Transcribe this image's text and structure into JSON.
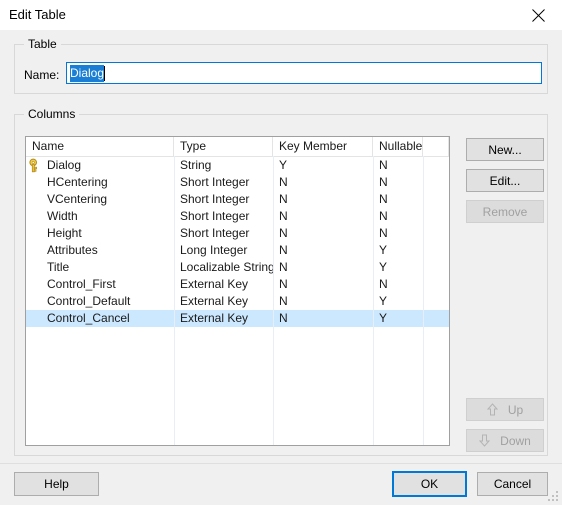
{
  "window": {
    "title": "Edit Table",
    "close_icon": "close-icon"
  },
  "table_group": {
    "legend": "Table",
    "name_label": "Name:",
    "name_value": "Dialog",
    "name_placeholder": ""
  },
  "columns_group": {
    "legend": "Columns",
    "headers": [
      "Name",
      "Type",
      "Key Member",
      "Nullable",
      ""
    ],
    "rows": [
      {
        "name": "Dialog",
        "type": "String",
        "key_member": "Y",
        "nullable": "N",
        "is_key": true,
        "selected": false
      },
      {
        "name": "HCentering",
        "type": "Short Integer",
        "key_member": "N",
        "nullable": "N",
        "is_key": false,
        "selected": false
      },
      {
        "name": "VCentering",
        "type": "Short Integer",
        "key_member": "N",
        "nullable": "N",
        "is_key": false,
        "selected": false
      },
      {
        "name": "Width",
        "type": "Short Integer",
        "key_member": "N",
        "nullable": "N",
        "is_key": false,
        "selected": false
      },
      {
        "name": "Height",
        "type": "Short Integer",
        "key_member": "N",
        "nullable": "N",
        "is_key": false,
        "selected": false
      },
      {
        "name": "Attributes",
        "type": "Long Integer",
        "key_member": "N",
        "nullable": "Y",
        "is_key": false,
        "selected": false
      },
      {
        "name": "Title",
        "type": "Localizable String",
        "key_member": "N",
        "nullable": "Y",
        "is_key": false,
        "selected": false
      },
      {
        "name": "Control_First",
        "type": "External Key",
        "key_member": "N",
        "nullable": "N",
        "is_key": false,
        "selected": false
      },
      {
        "name": "Control_Default",
        "type": "External Key",
        "key_member": "N",
        "nullable": "Y",
        "is_key": false,
        "selected": false
      },
      {
        "name": "Control_Cancel",
        "type": "External Key",
        "key_member": "N",
        "nullable": "Y",
        "is_key": false,
        "selected": true
      }
    ]
  },
  "side_buttons": {
    "new": "New...",
    "edit": "Edit...",
    "remove": "Remove",
    "up": "Up",
    "down": "Down"
  },
  "footer": {
    "help": "Help",
    "ok": "OK",
    "cancel": "Cancel"
  },
  "colors": {
    "dialog_bg": "#f0f0f0",
    "titlebar_bg": "#ffffff",
    "accent": "#0078d7",
    "selection_bg": "#cce8ff",
    "text_selection_bg": "#1a7fd4",
    "key_icon": "#e8b923",
    "disabled_text": "#a0a0a0"
  }
}
